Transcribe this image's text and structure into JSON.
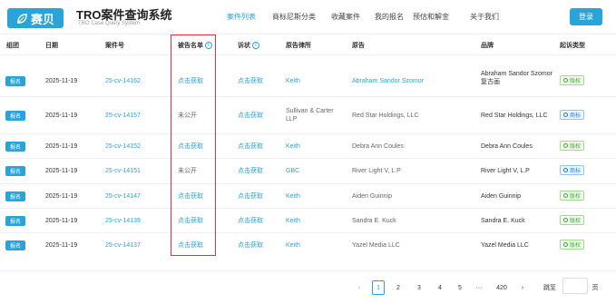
{
  "header": {
    "logo_text": "赛贝",
    "title": "TRO案件查询系统",
    "subtitle": "TRO Case Query System",
    "nav": [
      "案件列表",
      "商标尼斯分类",
      "收藏案件",
      "我的报名",
      "预估和解金",
      "关于我们"
    ],
    "login_label": "登录"
  },
  "table": {
    "columns": [
      "组团",
      "日期",
      "案件号",
      "被告名单",
      "诉状",
      "原告律所",
      "原告",
      "品牌",
      "起诉类型"
    ],
    "rows": [
      {
        "action": "报名",
        "date": "2025-11-19",
        "case_no": "25-cv-14162",
        "defendants": "点击获取",
        "complaint": "点击获取",
        "law_firm": "Keith",
        "plaintiff": "Abraham Sandor Szomor",
        "brand": "Abraham Sandor Szomor复古画",
        "type": "版权"
      },
      {
        "action": "报名",
        "date": "2025-11-19",
        "case_no": "25-cv-14157",
        "defendants": "未公开",
        "complaint": "点击获取",
        "law_firm": "Sullivan & Carter LLP",
        "plaintiff": "Red Star Holdings, LLC",
        "brand": "Red Star Holdings, LLC",
        "type": "商标"
      },
      {
        "action": "报名",
        "date": "2025-11-19",
        "case_no": "25-cv-14152",
        "defendants": "点击获取",
        "complaint": "点击获取",
        "law_firm": "Keith",
        "plaintiff": "Debra Ann Coules",
        "brand": "Debra Ann Coules",
        "type": "版权"
      },
      {
        "action": "报名",
        "date": "2025-11-19",
        "case_no": "25-cv-14151",
        "defendants": "未公开",
        "complaint": "点击获取",
        "law_firm": "GBC",
        "plaintiff": "River Light V, L.P",
        "brand": "River Light V, L.P",
        "type": "商标"
      },
      {
        "action": "报名",
        "date": "2025-11-19",
        "case_no": "25-cv-14147",
        "defendants": "点击获取",
        "complaint": "点击获取",
        "law_firm": "Keith",
        "plaintiff": "Aiden Guinnip",
        "brand": "Aiden Guinnip",
        "type": "版权"
      },
      {
        "action": "报名",
        "date": "2025-11-19",
        "case_no": "25-cv-14139",
        "defendants": "点击获取",
        "complaint": "点击获取",
        "law_firm": "Keith",
        "plaintiff": "Sandra E. Kuck",
        "brand": "Sandra E. Kuck",
        "type": "版权"
      },
      {
        "action": "报名",
        "date": "2025-11-19",
        "case_no": "25-cv-14137",
        "defendants": "点击获取",
        "complaint": "点击获取",
        "law_firm": "Keith",
        "plaintiff": "Yazel Media LLC",
        "brand": "Yazel Media LLC",
        "type": "版权"
      }
    ]
  },
  "pagination": {
    "pages": [
      "1",
      "2",
      "3",
      "4",
      "5"
    ],
    "ellipsis": "···",
    "last_page": "420",
    "goto_label": "跳至",
    "page_suffix": "页"
  },
  "colors": {
    "accent": "#2aa3d8",
    "highlight_border": "#d9363e",
    "copyright": "#3aa831",
    "trademark": "#1f7bd1"
  }
}
